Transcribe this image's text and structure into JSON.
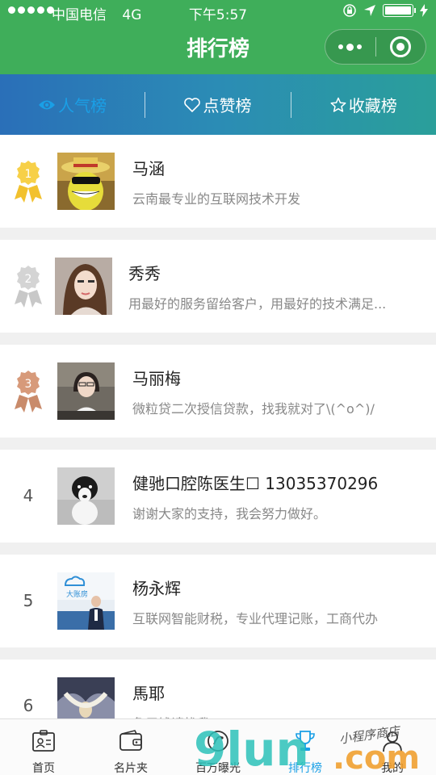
{
  "status_bar": {
    "carrier": "中国电信",
    "network": "4G",
    "time": "下午5:57"
  },
  "header": {
    "title": "排行榜"
  },
  "tabs": [
    {
      "label": "人气榜",
      "icon": "eye-icon",
      "active": true
    },
    {
      "label": "点赞榜",
      "icon": "heart-icon",
      "active": false
    },
    {
      "label": "收藏榜",
      "icon": "star-icon",
      "active": false
    }
  ],
  "ranking": [
    {
      "rank": "1",
      "name": "马涵",
      "desc": "云南最专业的互联网技术开发"
    },
    {
      "rank": "2",
      "name": "秀秀",
      "desc": "用最好的服务留给客户，用最好的技术满足..."
    },
    {
      "rank": "3",
      "name": "马丽梅",
      "desc": "微粒贷二次授信贷款，找我就对了\\(^o^)/"
    },
    {
      "rank": "4",
      "name": "健驰口腔陈医生☐ 13035370296",
      "desc": "谢谢大家的支持，我会努力做好。"
    },
    {
      "rank": "5",
      "name": "杨永辉",
      "desc": "互联网智能财税，专业代理记账，工商代办"
    },
    {
      "rank": "6",
      "name": "馬耶",
      "desc": "急用钱请找我"
    }
  ],
  "avatar_texts": {
    "rank5_logo": "大账房"
  },
  "nav": [
    {
      "label": "首页",
      "icon": "id-card-icon"
    },
    {
      "label": "名片夹",
      "icon": "wallet-icon"
    },
    {
      "label": "百万曝光",
      "icon": "exposure-icon"
    },
    {
      "label": "排行榜",
      "icon": "trophy-icon",
      "active": true
    },
    {
      "label": "我的",
      "icon": "user-icon"
    }
  ],
  "watermark": {
    "logo": "9lun",
    "suffix": ".com",
    "slogan": "小程序商店"
  },
  "colors": {
    "header_green": "#3fae5a",
    "tab_active": "#1a9fe6",
    "gold": "#f2c12e",
    "silver": "#c8c8c8",
    "bronze": "#c98b6b"
  }
}
